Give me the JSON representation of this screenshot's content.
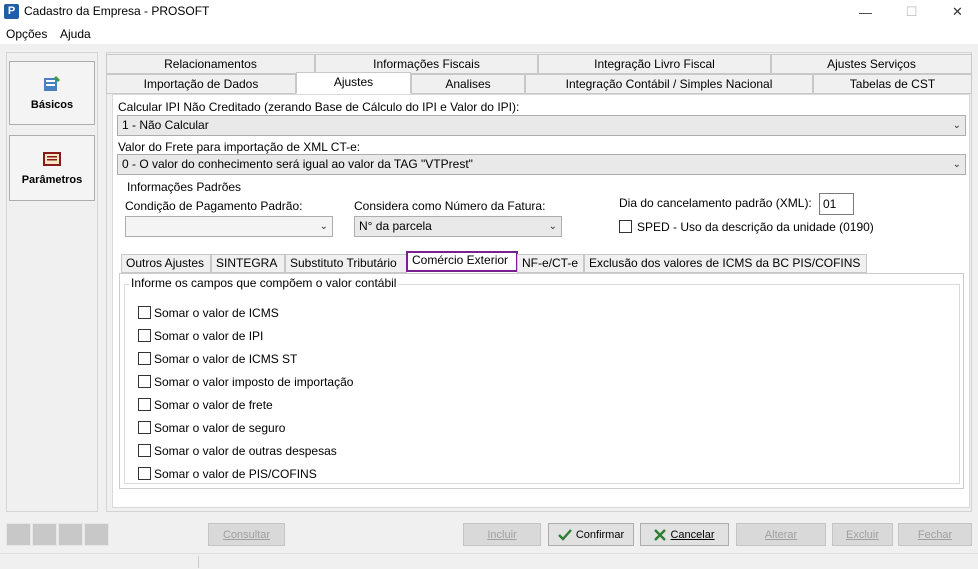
{
  "window": {
    "app_icon": "P",
    "title": "Cadastro da Empresa - PROSOFT",
    "minimize_icon": "—",
    "maximize_icon": "☐",
    "close_icon": "✕"
  },
  "menu": {
    "items": [
      {
        "label": "Opções"
      },
      {
        "label": "Ajuda"
      }
    ]
  },
  "sidebar": {
    "items": [
      {
        "label": "Básicos",
        "icon": "basics-icon"
      },
      {
        "label": "Parâmetros",
        "icon": "parameters-icon"
      }
    ]
  },
  "tabs": {
    "row1": [
      {
        "label": "Relacionamentos"
      },
      {
        "label": "Informações Fiscais"
      },
      {
        "label": "Integração Livro Fiscal"
      },
      {
        "label": "Ajustes Serviços"
      }
    ],
    "row2": [
      {
        "label": "Importação de Dados"
      },
      {
        "label": "Ajustes"
      },
      {
        "label": "Analises"
      },
      {
        "label": "Integração Contábil / Simples Nacional"
      },
      {
        "label": "Tabelas de CST"
      }
    ]
  },
  "form": {
    "ipi_label": "Calcular IPI Não Creditado (zerando Base de Cálculo do IPI e Valor do IPI):",
    "ipi_value": "1 - Não Calcular",
    "frete_label": "Valor do Frete para importação de XML CT-e:",
    "frete_value": "0 - O valor do conhecimento será igual ao valor da TAG \"VTPrest\"",
    "info_group_title": "Informações Padrões",
    "cond_label": "Condição de Pagamento Padrão:",
    "cond_value": "",
    "fatura_label": "Considera como Número da Fatura:",
    "fatura_value": "N° da parcela",
    "dia_label": "Dia do cancelamento padrão (XML):",
    "dia_value": "01",
    "sped_label": "SPED - Uso da descrição da unidade (0190)"
  },
  "subtabs": [
    {
      "label": "Outros Ajustes"
    },
    {
      "label": "SINTEGRA"
    },
    {
      "label": "Substituto Tributário"
    },
    {
      "label": "Comércio Exterior"
    },
    {
      "label": "NF-e/CT-e"
    },
    {
      "label": "Exclusão dos valores de ICMS da BC PIS/COFINS"
    }
  ],
  "comercio": {
    "group_title": "Informe os campos que compõem o valor contábil",
    "checkboxes": [
      {
        "label": "Somar o  valor de ICMS"
      },
      {
        "label": "Somar o valor de IPI"
      },
      {
        "label": "Somar o valor de ICMS ST"
      },
      {
        "label": "Somar o valor imposto de importação"
      },
      {
        "label": "Somar o valor de frete"
      },
      {
        "label": "Somar o valor de seguro"
      },
      {
        "label": "Somar o valor de outras despesas"
      },
      {
        "label": "Somar o valor de PIS/COFINS"
      }
    ]
  },
  "buttons": {
    "consultar": "Consultar",
    "incluir": "Incluir",
    "confirmar": "Confirmar",
    "cancelar": "Cancelar",
    "alterar": "Alterar",
    "excluir": "Excluir",
    "fechar": "Fechar"
  },
  "colors": {
    "active_subtab_border": "#7a1f8e",
    "confirm_icon": "#2e7d32",
    "cancel_icon": "#2e7d32"
  }
}
